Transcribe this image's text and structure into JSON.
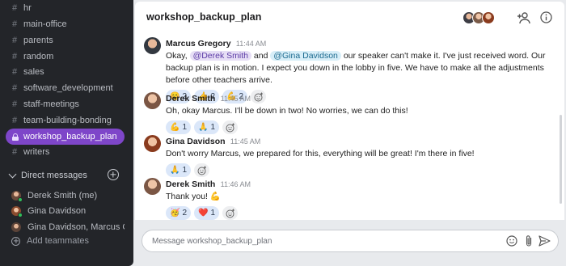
{
  "sidebar": {
    "channels": [
      {
        "label": "hr"
      },
      {
        "label": "main-office"
      },
      {
        "label": "parents"
      },
      {
        "label": "random"
      },
      {
        "label": "sales"
      },
      {
        "label": "software_development"
      },
      {
        "label": "staff-meetings"
      },
      {
        "label": "team-building-bonding"
      },
      {
        "label": "workshop_backup_plan",
        "active": true
      },
      {
        "label": "writers"
      }
    ],
    "direct_messages_title": "Direct messages",
    "direct_messages": [
      {
        "label": "Derek Smith (me)"
      },
      {
        "label": "Gina Davidson"
      },
      {
        "label": "Gina Davidson, Marcus G..."
      }
    ],
    "add_teammates": "Add teammates"
  },
  "header": {
    "title": "workshop_backup_plan",
    "icons": [
      "add-member-icon",
      "info-icon"
    ]
  },
  "messages": [
    {
      "author": "Marcus Gregory",
      "time": "11:44 AM",
      "text_before": "Okay, ",
      "mention1": "@Derek Smith",
      "text_mid": " and ",
      "mention2": "@Gina Davidson",
      "text_after": " our speaker can't make it. I've just received word. Our backup plan is in motion. I expect you down in the lobby in five. We have to make all the adjustments before other teachers arrive.",
      "reactions": [
        {
          "emoji": "😊",
          "count": "2"
        },
        {
          "emoji": "👍",
          "count": "2"
        },
        {
          "emoji": "💪",
          "count": "2"
        }
      ]
    },
    {
      "author": "Derek Smith",
      "time": "11:45 AM",
      "text": "Oh, okay Marcus. I'll be down in two! No worries, we can do this!",
      "reactions": [
        {
          "emoji": "💪",
          "count": "1"
        },
        {
          "emoji": "🙏",
          "count": "1"
        }
      ]
    },
    {
      "author": "Gina Davidson",
      "time": "11:45 AM",
      "text": "Don't worry Marcus, we prepared for this, everything will be great! I'm there in five!",
      "reactions": [
        {
          "emoji": "🙏",
          "count": "1"
        }
      ]
    },
    {
      "author": "Derek Smith",
      "time": "11:46 AM",
      "text": "Thank you! 💪",
      "reactions": [
        {
          "emoji": "🥳",
          "count": "2"
        },
        {
          "emoji": "❤️",
          "count": "1"
        }
      ]
    }
  ],
  "composer": {
    "placeholder": "Message workshop_backup_plan",
    "icons": [
      "emoji-icon",
      "attach-icon",
      "send-icon"
    ]
  },
  "colors": {
    "sidebar_bg": "#232529",
    "active_channel": "#7e46c9",
    "reaction_bg": "#dbe7f9",
    "mention_bg": "#e6def5"
  }
}
